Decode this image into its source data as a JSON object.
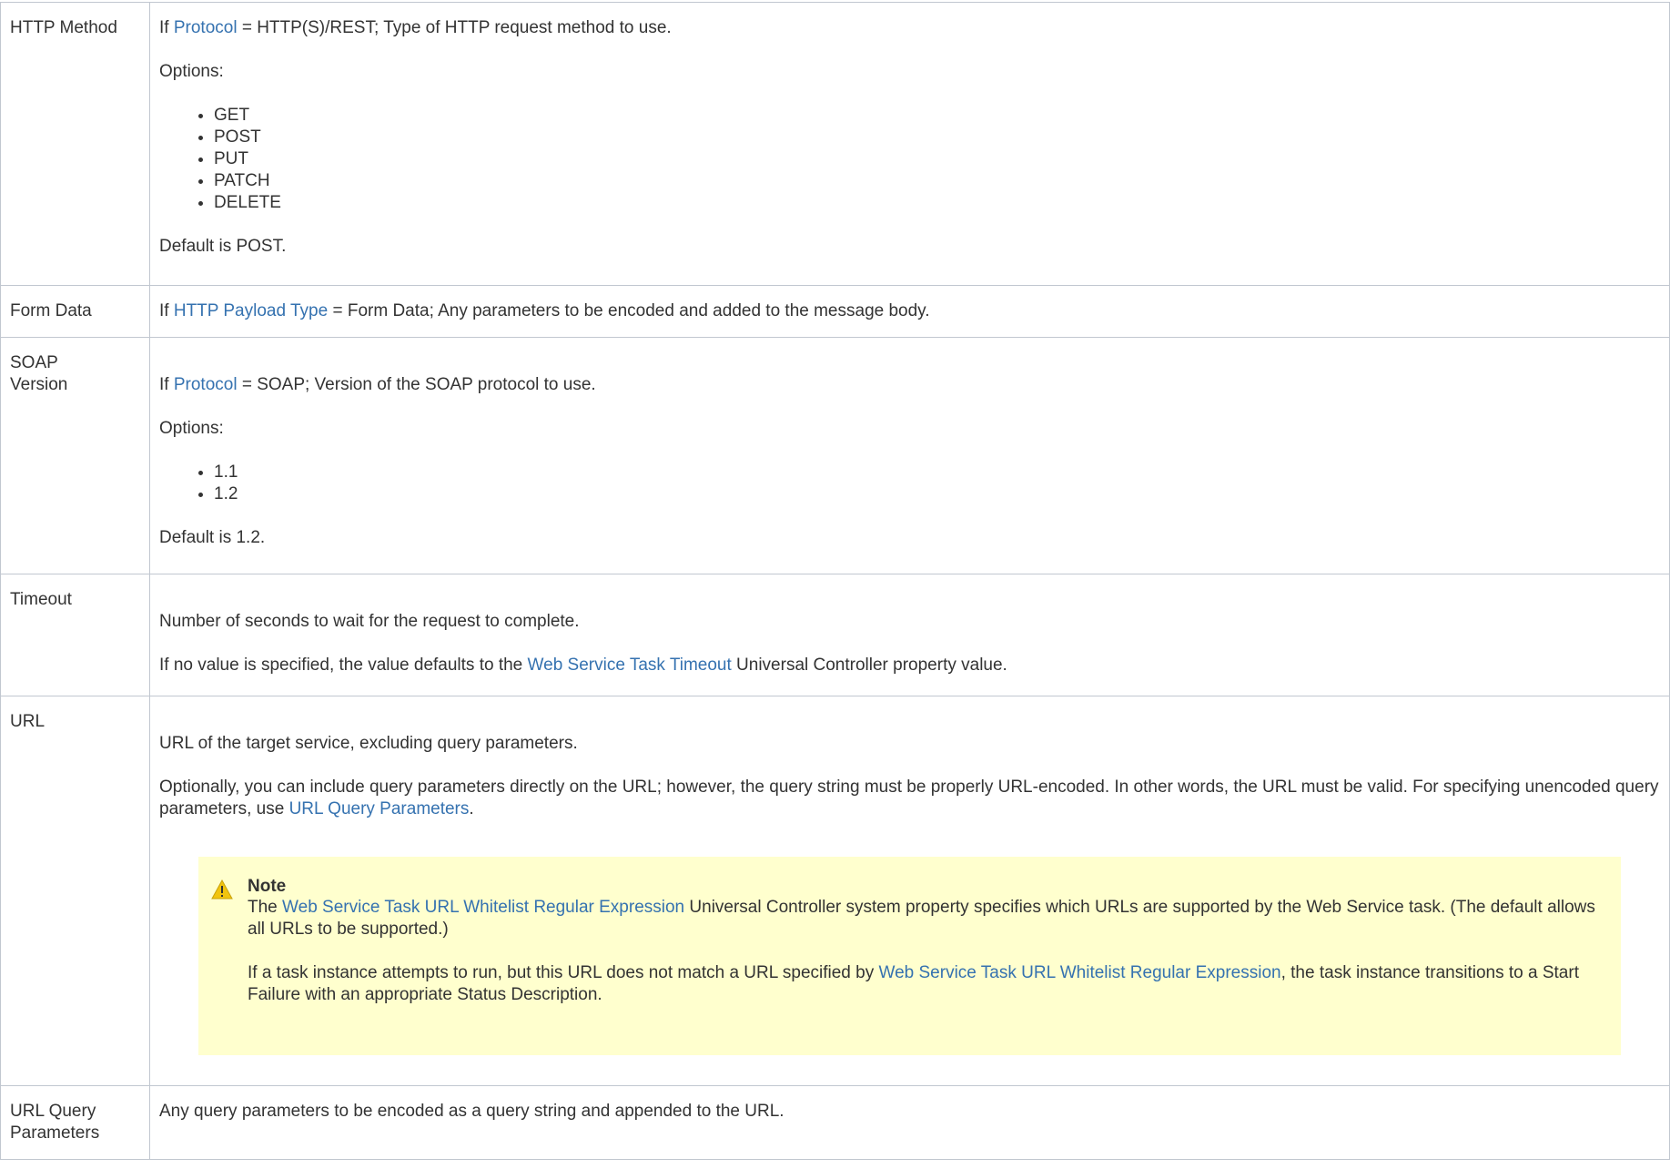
{
  "rows": {
    "http_method": {
      "label": "HTTP Method",
      "line1_pre": "If ",
      "line1_link": "Protocol",
      "line1_post": " = HTTP(S)/REST; Type of HTTP request method to use.",
      "options_label": "Options:",
      "options": [
        "GET",
        "POST",
        "PUT",
        "PATCH",
        "DELETE"
      ],
      "default": "Default is POST."
    },
    "form_data": {
      "label": "Form Data",
      "line1_pre": "If ",
      "line1_link": "HTTP Payload Type",
      "line1_post": " = Form Data; Any parameters to be encoded and added to the message body."
    },
    "soap_version": {
      "label_line1": "SOAP",
      "label_line2": "Version",
      "line1_pre": "If ",
      "line1_link": "Protocol",
      "line1_post": " = SOAP; Version of the SOAP protocol to use.",
      "options_label": "Options:",
      "options": [
        "1.1",
        "1.2"
      ],
      "default": "Default is 1.2."
    },
    "timeout": {
      "label": "Timeout",
      "line1": "Number of seconds to wait for the request to complete.",
      "line2_pre": "If no value is specified, the value defaults to the ",
      "line2_link": "Web Service Task Timeout",
      "line2_post": " Universal Controller property value."
    },
    "url": {
      "label": "URL",
      "line1": "URL of the target service, excluding query parameters.",
      "line2_pre": "Optionally, you can include query parameters directly on the URL; however, the query string must be properly URL-encoded. In other words, the URL must be valid. For specifying unencoded query parameters, use ",
      "line2_link": "URL Query Parameters",
      "line2_post": ".",
      "note": {
        "title": "Note",
        "p1_pre": "The ",
        "p1_link": "Web Service Task URL Whitelist Regular Expression",
        "p1_post": " Universal Controller system property specifies which URLs are supported by the Web Service task. (The default allows all URLs to be supported.)",
        "p2_pre": "If a task instance attempts to run, but this URL does not match a URL specified by ",
        "p2_link": "Web Service Task URL Whitelist Regular Expression",
        "p2_post": ", the task instance transitions to a Start Failure with an appropriate Status Description."
      }
    },
    "url_query_parameters": {
      "label_line1": "URL Query",
      "label_line2": "Parameters",
      "line1": "Any query parameters to be encoded as a query string and appended to the URL."
    }
  },
  "colors": {
    "link": "#3572b0",
    "text": "#333333",
    "border": "#c1c7d0",
    "note_bg": "#ffffce",
    "warning_icon": "#f1c40f"
  },
  "icons": {
    "note": "warning-icon"
  }
}
